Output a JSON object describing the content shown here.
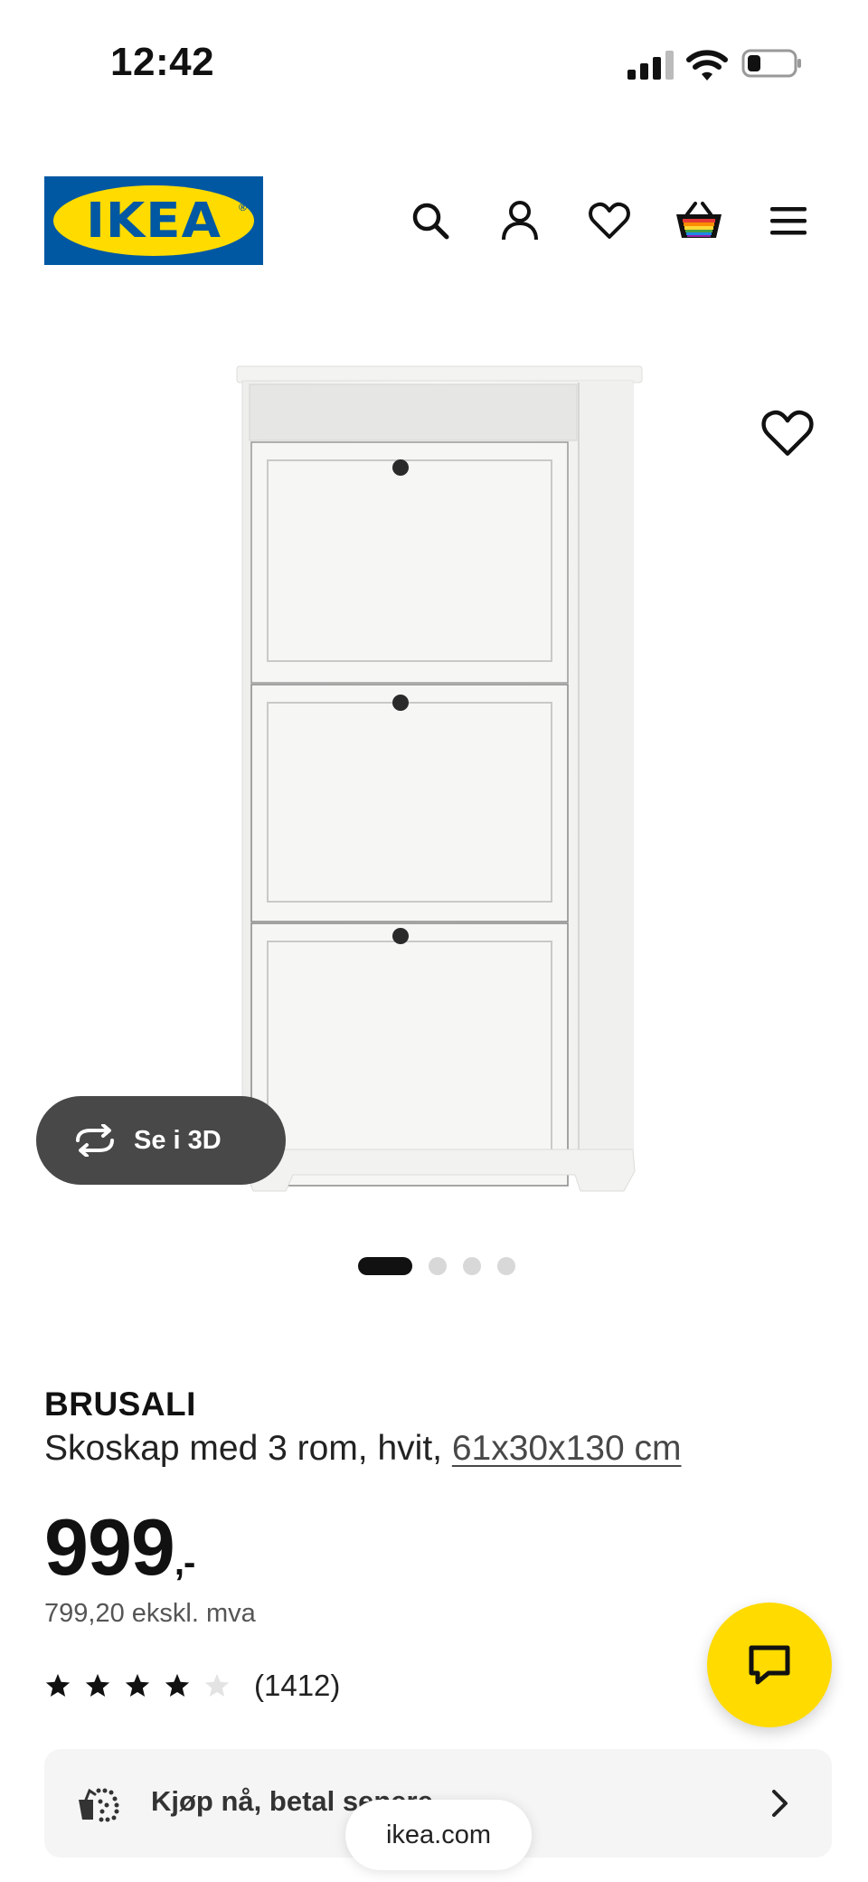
{
  "status_bar": {
    "time": "12:42"
  },
  "header": {
    "logo_text": "IKEA",
    "logo_reg": "®"
  },
  "gallery": {
    "view_3d_label": "Se i 3D",
    "image_count": 4,
    "active_index": 0
  },
  "product": {
    "brand": "BRUSALI",
    "description": "Skoskap med 3 rom, hvit, ",
    "dimensions": "61x30x130 cm",
    "price_main": "999",
    "price_suffix": ",-",
    "price_ex_vat": "799,20 ekskl. mva",
    "rating_stars": 4,
    "rating_max": 5,
    "rating_count": "(1412)"
  },
  "bnpl": {
    "label": "Kjøp nå, betal senere"
  },
  "browser": {
    "url": "ikea.com"
  },
  "colors": {
    "ikea_blue": "#0058a3",
    "ikea_yellow": "#ffdb00",
    "btn_dark": "#484848"
  },
  "icons": [
    "search-icon",
    "account-icon",
    "heart-icon",
    "basket-icon",
    "menu-icon",
    "rotate-3d-icon",
    "chat-icon",
    "installment-icon",
    "chevron-right-icon",
    "star-icon"
  ]
}
